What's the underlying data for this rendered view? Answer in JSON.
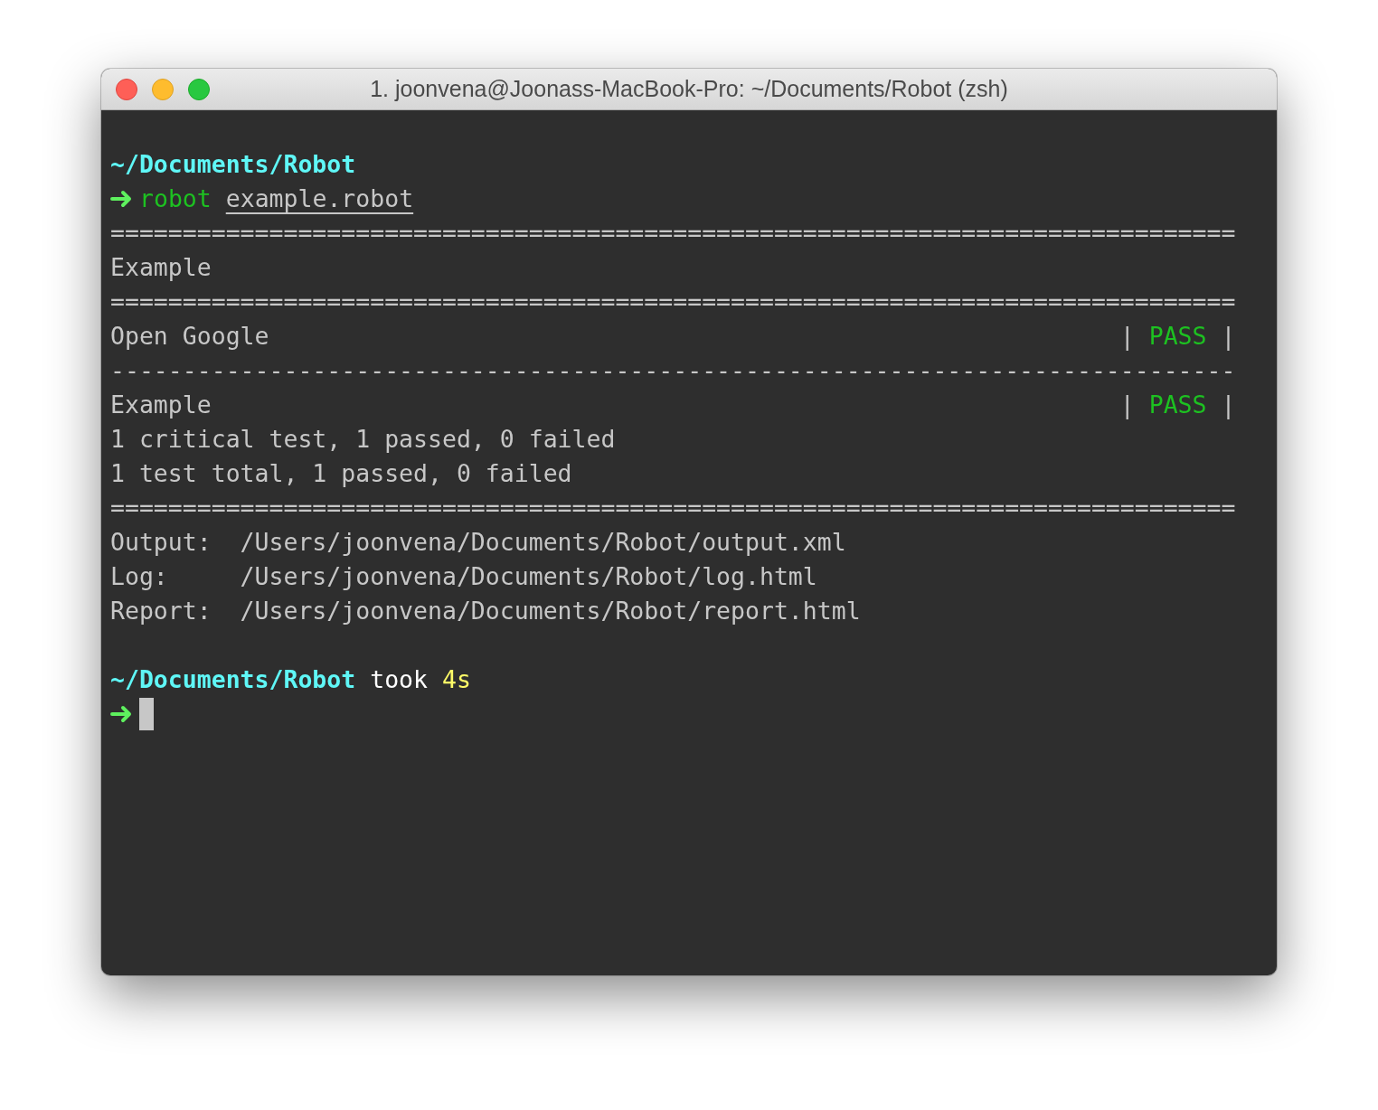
{
  "window": {
    "title": "1. joonvena@Joonass-MacBook-Pro: ~/Documents/Robot (zsh)"
  },
  "terminal": {
    "lines": [
      {
        "kind": "blank"
      },
      {
        "kind": "path",
        "path": "~/Documents/Robot"
      },
      {
        "kind": "command",
        "command": "robot",
        "argument": "example.robot"
      },
      {
        "kind": "rule",
        "text": "=============================================================================="
      },
      {
        "kind": "text",
        "text": "Example"
      },
      {
        "kind": "rule",
        "text": "=============================================================================="
      },
      {
        "kind": "result",
        "name": "Open Google",
        "status": "| PASS |"
      },
      {
        "kind": "rule",
        "text": "------------------------------------------------------------------------------"
      },
      {
        "kind": "result",
        "name": "Example",
        "status": "| PASS |"
      },
      {
        "kind": "text",
        "text": "1 critical test, 1 passed, 0 failed"
      },
      {
        "kind": "text",
        "text": "1 test total, 1 passed, 0 failed"
      },
      {
        "kind": "rule",
        "text": "=============================================================================="
      },
      {
        "kind": "text",
        "text": "Output:  /Users/joonvena/Documents/Robot/output.xml"
      },
      {
        "kind": "text",
        "text": "Log:     /Users/joonvena/Documents/Robot/log.html"
      },
      {
        "kind": "text",
        "text": "Report:  /Users/joonvena/Documents/Robot/report.html"
      },
      {
        "kind": "blank"
      },
      {
        "kind": "path",
        "path": "~/Documents/Robot",
        "took": "took",
        "duration": "4s"
      },
      {
        "kind": "prompt",
        "cursor": true
      }
    ]
  }
}
